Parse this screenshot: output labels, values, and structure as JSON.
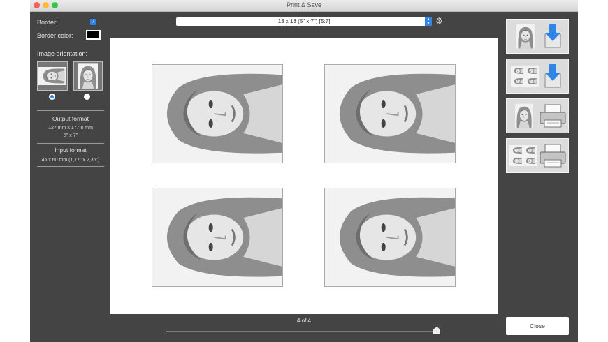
{
  "window": {
    "title": "Print & Save"
  },
  "sidebar": {
    "border_label": "Border:",
    "border_checked": true,
    "border_color_label": "Border color:",
    "border_color": "#000000",
    "orientation_label": "Image orientation:",
    "orientation_selected": "landscape",
    "output_heading": "Output format",
    "output_mm": "127 mm x 177,8 mm",
    "output_in": "5\" x 7\"",
    "input_heading": "Input format",
    "input_size": "45 x 60 mm (1,77\" x 2,36\")"
  },
  "toolbar": {
    "format_value": "13 x 18 (5\" x 7\") [5:7]"
  },
  "preview": {
    "page_indicator": "4 of 4",
    "page_current": 4,
    "page_total": 4
  },
  "actions": {
    "buttons": [
      {
        "name": "save-single-button",
        "icon": "download-icon"
      },
      {
        "name": "save-sheet-button",
        "icon": "download-icon"
      },
      {
        "name": "print-single-button",
        "icon": "printer-icon"
      },
      {
        "name": "print-sheet-button",
        "icon": "printer-icon"
      }
    ],
    "close_label": "Close"
  },
  "colors": {
    "accent": "#2f86e8",
    "window_bg": "#444444"
  }
}
